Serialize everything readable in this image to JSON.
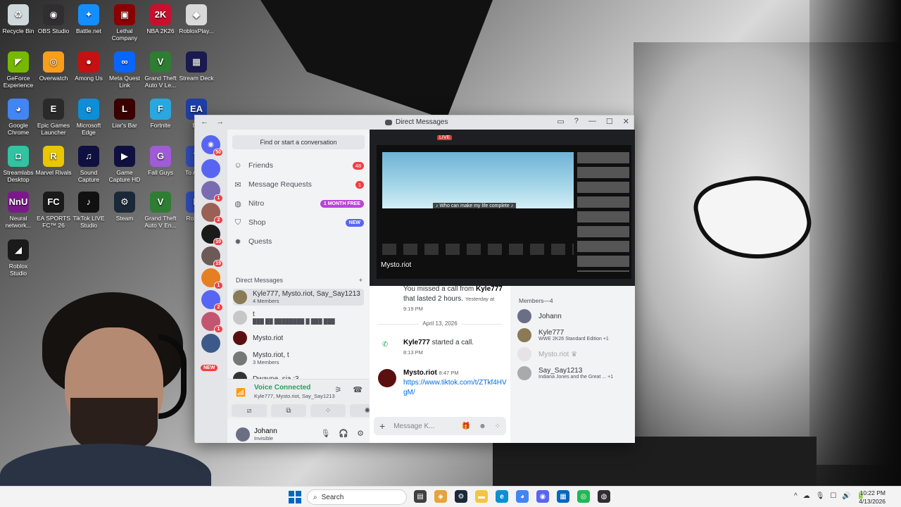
{
  "desktop": {
    "icons": [
      {
        "label": "Recycle Bin",
        "glyph": "♻",
        "color": "#cfd8dc"
      },
      {
        "label": "OBS Studio",
        "glyph": "◉",
        "color": "#302e31"
      },
      {
        "label": "Battle.net",
        "glyph": "✦",
        "color": "#148eff"
      },
      {
        "label": "Lethal Company",
        "glyph": "▣",
        "color": "#8b0000"
      },
      {
        "label": "NBA 2K26",
        "glyph": "2K",
        "color": "#c8102e"
      },
      {
        "label": "RobloxPlay...",
        "glyph": "◆",
        "color": "#d9d9d9"
      },
      {
        "label": "GeForce Experience",
        "glyph": "◤",
        "color": "#76b900"
      },
      {
        "label": "Overwatch",
        "glyph": "◎",
        "color": "#f99e1a"
      },
      {
        "label": "Among Us",
        "glyph": "●",
        "color": "#c51111"
      },
      {
        "label": "Meta Quest Link",
        "glyph": "∞",
        "color": "#0866ff"
      },
      {
        "label": "Grand Theft Auto V Le...",
        "glyph": "V",
        "color": "#2e7d32"
      },
      {
        "label": "Stream Deck",
        "glyph": "▦",
        "color": "#1a1a4e"
      },
      {
        "label": "Google Chrome",
        "glyph": "◕",
        "color": "#4285f4"
      },
      {
        "label": "Epic Games Launcher",
        "glyph": "E",
        "color": "#2a2a2a"
      },
      {
        "label": "Microsoft Edge",
        "glyph": "e",
        "color": "#0c8fd6"
      },
      {
        "label": "Liar's Bar",
        "glyph": "L",
        "color": "#3a0000"
      },
      {
        "label": "Fortnite",
        "glyph": "F",
        "color": "#2aa7e0"
      },
      {
        "label": "EA",
        "glyph": "EA",
        "color": "#1e3fa8"
      },
      {
        "label": "Streamlabs Desktop",
        "glyph": "◘",
        "color": "#31c3a2"
      },
      {
        "label": "Marvel Rivals",
        "glyph": "R",
        "color": "#e8c700"
      },
      {
        "label": "Sound Capture",
        "glyph": "♫",
        "color": "#101040"
      },
      {
        "label": "Game Capture HD",
        "glyph": "▶",
        "color": "#101040"
      },
      {
        "label": "Fall Guys",
        "glyph": "G",
        "color": "#a05cd6"
      },
      {
        "label": "To Acc...",
        "glyph": "T",
        "color": "#3050c0"
      },
      {
        "label": "Neural network...",
        "glyph": "NnU",
        "color": "#7a1a8a"
      },
      {
        "label": "EA SPORTS FC™ 26",
        "glyph": "FC",
        "color": "#1a1a1a"
      },
      {
        "label": "TikTok LIVE Studio",
        "glyph": "♪",
        "color": "#111"
      },
      {
        "label": "Steam",
        "glyph": "⚙",
        "color": "#1b2838"
      },
      {
        "label": "Grand Theft Auto V En...",
        "glyph": "V",
        "color": "#2e7d32"
      },
      {
        "label": "Roblo...",
        "glyph": "R",
        "color": "#3050c0"
      },
      {
        "label": "Roblox Studio",
        "glyph": "◢",
        "color": "#1a1a1a"
      }
    ]
  },
  "window": {
    "title": "Direct Messages",
    "nav_back": "←",
    "nav_forward": "→",
    "controls": {
      "inbox": "▭",
      "help": "?",
      "minimize": "—",
      "maximize": "☐",
      "close": "✕"
    }
  },
  "rail": {
    "home_badge": "50",
    "servers": [
      {
        "color": "#5865f2",
        "badge": ""
      },
      {
        "color": "#7a6cb0",
        "badge": "1"
      },
      {
        "color": "#9a5f55",
        "badge": "2"
      },
      {
        "color": "#1a1a1a",
        "badge": "10"
      },
      {
        "color": "#6c5a57",
        "badge": "19"
      },
      {
        "color": "#e67e22",
        "badge": "1"
      },
      {
        "color": "#5865f2",
        "badge": "2"
      },
      {
        "color": "#c25670",
        "badge": "1"
      },
      {
        "color": "#3b5a8a",
        "badge": ""
      }
    ],
    "new_label": "NEW"
  },
  "channels": {
    "search_placeholder": "Find or start a conversation",
    "nav": [
      {
        "label": "Friends",
        "icon": "☺",
        "badge": "48"
      },
      {
        "label": "Message Requests",
        "icon": "✉",
        "badge": "1"
      },
      {
        "label": "Nitro",
        "icon": "◍",
        "pill": "1 MONTH FREE",
        "pill_color": "#b845d6"
      },
      {
        "label": "Shop",
        "icon": "⛉",
        "pill": "NEW",
        "pill_color": "#5865f2"
      },
      {
        "label": "Quests",
        "icon": "✹"
      }
    ],
    "dm_header": "Direct Messages",
    "dm_add": "+",
    "dms": [
      {
        "name": "Kyle777, Mysto.riot, Say_Say1213",
        "sub": "4 Members",
        "color": "#8a7a55"
      },
      {
        "name": "t",
        "sub": "███ ██ ████████ █ ███ ███",
        "color": "#c7c7c7"
      },
      {
        "name": "Mysto.riot",
        "sub": "",
        "color": "#5a1010"
      },
      {
        "name": "Mysto.riot, t",
        "sub": "3 Members",
        "color": "#777"
      },
      {
        "name": "Dwayne_sia :3",
        "sub": "",
        "color": "#333"
      }
    ],
    "voice": {
      "title": "Voice Connected",
      "sub": "Kyle777, Mysto.riot, Say_Say1213",
      "icon": "📶",
      "act1": "⚞",
      "act2": "☎",
      "buttons": [
        "⧄",
        "⧉",
        "⁘",
        "✺"
      ]
    },
    "user": {
      "name": "Johann",
      "status": "Invisible",
      "mic": "🎙",
      "headset": "🎧",
      "settings": "⚙"
    }
  },
  "stream": {
    "name": "Mysto.riot",
    "live": "LIVE",
    "caption": "♪ Who can make my life complete ♪"
  },
  "chat": {
    "missed_pre": "You missed a call from",
    "missed_user": "Kyle777",
    "missed_post": "that lasted 2 hours.",
    "missed_time": "Yesterday at 9:19 PM",
    "date_sep": "April 13, 2026",
    "call_user": "Kyle777",
    "call_text": "started a call.",
    "call_time": "8:13 PM",
    "msg_user": "Mysto.riot",
    "msg_time": "8:47 PM",
    "msg_link": "https://www.tiktok.com/t/ZTkf4HVgM/",
    "composer_placeholder": "Message K...",
    "composer_plus": "+",
    "composer_icons": [
      "🎁",
      "☻",
      "⁘"
    ]
  },
  "members": {
    "header": "Members—4",
    "list": [
      {
        "name": "Johann",
        "activity": "",
        "color": "#6b6f86"
      },
      {
        "name": "Kyle777",
        "activity": "WWE 2K26 Standard Edition +1",
        "color": "#8a7a55"
      },
      {
        "name": "Mysto.riot ♛",
        "activity": "",
        "color": "#d8c8c8",
        "faded": true
      },
      {
        "name": "Say_Say1213",
        "activity": "Indiana Jones and the Great ... +1",
        "color": "#aaaaaa"
      }
    ]
  },
  "taskbar": {
    "search": "Search",
    "search_icon": "⌕",
    "apps": [
      {
        "glyph": "▤",
        "color": "#404040"
      },
      {
        "glyph": "◈",
        "color": "#e6a23c"
      },
      {
        "glyph": "⚙",
        "color": "#1b2838"
      },
      {
        "glyph": "▬",
        "color": "#f4c542"
      },
      {
        "glyph": "e",
        "color": "#0c8fd6"
      },
      {
        "glyph": "◕",
        "color": "#4285f4"
      },
      {
        "glyph": "◉",
        "color": "#5865f2"
      },
      {
        "glyph": "▦",
        "color": "#0067c0"
      },
      {
        "glyph": "◎",
        "color": "#1db954"
      },
      {
        "glyph": "◍",
        "color": "#302e31"
      }
    ],
    "tray": [
      "^",
      "☁",
      "🎙",
      "☐",
      "🔊",
      "🔋"
    ],
    "time": "10:22 PM",
    "date": "4/13/2026"
  }
}
